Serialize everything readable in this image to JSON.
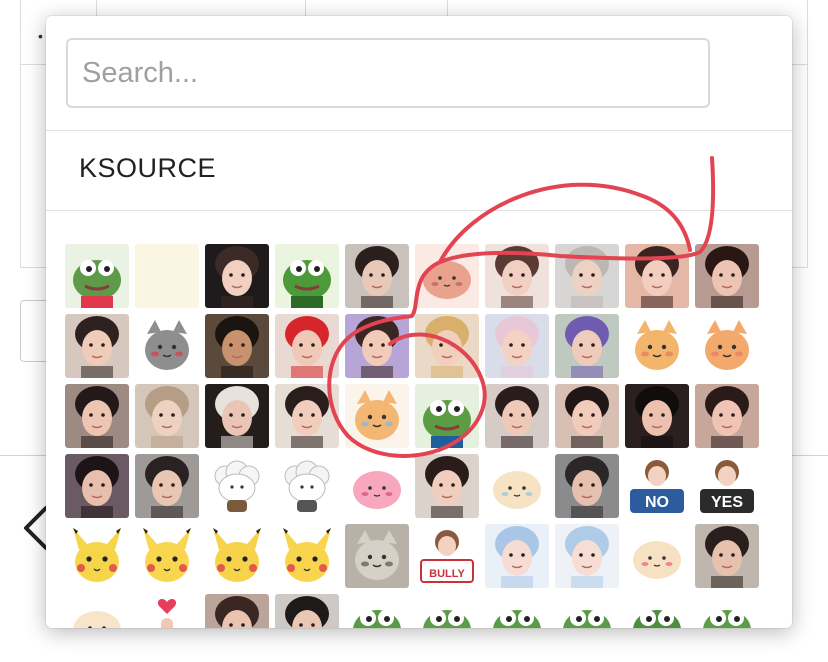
{
  "search": {
    "placeholder": "Search..."
  },
  "section": {
    "title": "KSOURCE"
  },
  "emotes": [
    {
      "name": "peepo-heart",
      "kind": "frog",
      "bg": "#e9f2e3",
      "fg": "#5d9a4a",
      "acc": "#e0394b"
    },
    {
      "name": "duck-cry",
      "kind": "duck",
      "bg": "#fbf6e4",
      "fg": "#f5dd6a",
      "acc": "#f29bb0"
    },
    {
      "name": "girl-pray",
      "kind": "face",
      "bg": "#1f1b1c",
      "fg": "#f1cfc1",
      "acc": "#3b2a26"
    },
    {
      "name": "pepe-dance",
      "kind": "frog",
      "bg": "#eaf4df",
      "fg": "#4c9a3a",
      "acc": "#2d6a26"
    },
    {
      "name": "girl-dab",
      "kind": "face",
      "bg": "#c9c1bc",
      "fg": "#e8c9b8",
      "acc": "#2a1f1d"
    },
    {
      "name": "potato-blob",
      "kind": "blob",
      "bg": "#fbe9e3",
      "fg": "#e8a28d",
      "acc": "#b66a5c"
    },
    {
      "name": "girl-yawn",
      "kind": "face",
      "bg": "#efe1dc",
      "fg": "#f2cfc3",
      "acc": "#5a3a33"
    },
    {
      "name": "boy-smirk",
      "kind": "face",
      "bg": "#d7d6d4",
      "fg": "#efd1c3",
      "acc": "#bdb7b3"
    },
    {
      "name": "girl-hands",
      "kind": "face",
      "bg": "#e4b7a7",
      "fg": "#f3cdbd",
      "acc": "#3b2320"
    },
    {
      "name": "girl-sad",
      "kind": "face",
      "bg": "#b79b92",
      "fg": "#ecc4b4",
      "acc": "#2a1714"
    },
    {
      "name": "boy-closeup",
      "kind": "face",
      "bg": "#d6c7bf",
      "fg": "#efcbb9",
      "acc": "#2e2220"
    },
    {
      "name": "cat-heart",
      "kind": "cat",
      "bg": "#ffffff",
      "fg": "#8e8e8e",
      "acc": "#e0394b"
    },
    {
      "name": "man-grin",
      "kind": "face",
      "bg": "#5b4a3c",
      "fg": "#c9926f",
      "acc": "#1b1511"
    },
    {
      "name": "red-glasses",
      "kind": "face",
      "bg": "#e8d9d3",
      "fg": "#f0c8b6",
      "acc": "#d7262b"
    },
    {
      "name": "girl-purple",
      "kind": "face",
      "bg": "#b7a5d8",
      "fg": "#f1cab9",
      "acc": "#3a2724"
    },
    {
      "name": "boy-blond",
      "kind": "face",
      "bg": "#e9d9c6",
      "fg": "#f1cfbc",
      "acc": "#d9b06b"
    },
    {
      "name": "girl-sip",
      "kind": "face",
      "bg": "#d9dde9",
      "fg": "#f3d2c4",
      "acc": "#e8c7d6"
    },
    {
      "name": "girl-drink",
      "kind": "face",
      "bg": "#c0c9c0",
      "fg": "#efcbbb",
      "acc": "#6f5bb0"
    },
    {
      "name": "cat-pout",
      "kind": "cat",
      "bg": "#ffffff",
      "fg": "#f2b56b",
      "acc": "#e07a5f"
    },
    {
      "name": "cat-cry",
      "kind": "cat",
      "bg": "#ffffff",
      "fg": "#f4a96c",
      "acc": "#e27b62"
    },
    {
      "name": "girl-smile",
      "kind": "face",
      "bg": "#9d8a82",
      "fg": "#edc6b3",
      "acc": "#23191a"
    },
    {
      "name": "girl-blur",
      "kind": "face",
      "bg": "#d4c6b9",
      "fg": "#eed2c1",
      "acc": "#b69e86"
    },
    {
      "name": "girl-math",
      "kind": "face",
      "bg": "#251d1c",
      "fg": "#eac4b4",
      "acc": "#e8e2dc"
    },
    {
      "name": "girl-lips",
      "kind": "face",
      "bg": "#e6ddd5",
      "fg": "#f0cdbd",
      "acc": "#2a1e1c"
    },
    {
      "name": "cat-sweat",
      "kind": "cat",
      "bg": "#fbf4ea",
      "fg": "#f3b773",
      "acc": "#7fb6e6"
    },
    {
      "name": "pepe-shy",
      "kind": "frog",
      "bg": "#e6f0de",
      "fg": "#5c9c45",
      "acc": "#1f5e9c"
    },
    {
      "name": "girl-shock",
      "kind": "face",
      "bg": "#d6ccc7",
      "fg": "#efc9b8",
      "acc": "#2a1c1b"
    },
    {
      "name": "girl-cheek",
      "kind": "face",
      "bg": "#d8bfb4",
      "fg": "#f1cbbb",
      "acc": "#1f1616"
    },
    {
      "name": "girl-hairhold",
      "kind": "face",
      "bg": "#2a2020",
      "fg": "#ecc1b0",
      "acc": "#120d0d"
    },
    {
      "name": "girl-pink",
      "kind": "face",
      "bg": "#c8a79b",
      "fg": "#efc4b4",
      "acc": "#2a1a18"
    },
    {
      "name": "girl-think",
      "kind": "face",
      "bg": "#6a5a63",
      "fg": "#e8bfae",
      "acc": "#1c1417"
    },
    {
      "name": "boy-point",
      "kind": "face",
      "bg": "#9e9a98",
      "fg": "#e9c6b4",
      "acc": "#2a2222"
    },
    {
      "name": "sheep-dance",
      "kind": "sheep",
      "bg": "#ffffff",
      "fg": "#f6f6f6",
      "acc": "#7a5a3a"
    },
    {
      "name": "sheep-run",
      "kind": "sheep",
      "bg": "#ffffff",
      "fg": "#f4f4f4",
      "acc": "#555555"
    },
    {
      "name": "pink-bunny",
      "kind": "blob",
      "bg": "#ffffff",
      "fg": "#f7a8bf",
      "acc": "#d9567f"
    },
    {
      "name": "girl-straw",
      "kind": "face",
      "bg": "#dcd2cc",
      "fg": "#f1cdbd",
      "acc": "#2a1c1b"
    },
    {
      "name": "blob-tea",
      "kind": "blob",
      "bg": "#ffffff",
      "fg": "#f6e3c4",
      "acc": "#9cc7dc"
    },
    {
      "name": "boy-stare",
      "kind": "face",
      "bg": "#8b8a8c",
      "fg": "#e6c0ae",
      "acc": "#2b2627"
    },
    {
      "name": "no-sign",
      "kind": "sign",
      "bg": "#ffffff",
      "fg": "#2c5b9e",
      "acc": "#8a5a3d",
      "text": "NO"
    },
    {
      "name": "yes-sign",
      "kind": "sign",
      "bg": "#ffffff",
      "fg": "#2b2b2b",
      "acc": "#8a5a3d",
      "text": "YES"
    },
    {
      "name": "pikachu-gun",
      "kind": "pika",
      "bg": "#ffffff",
      "fg": "#f7d54a",
      "acc": "#333333"
    },
    {
      "name": "pikachu-hide",
      "kind": "pika",
      "bg": "#ffffff",
      "fg": "#f8d650",
      "acc": "#2c2c2c"
    },
    {
      "name": "pikachu-smile",
      "kind": "pika",
      "bg": "#ffffff",
      "fg": "#f6d34b",
      "acc": "#e35a4b"
    },
    {
      "name": "pikachu-heart",
      "kind": "pika",
      "bg": "#ffffff",
      "fg": "#f8d54c",
      "acc": "#e94b6a"
    },
    {
      "name": "cat-sad",
      "kind": "cat",
      "bg": "#b7b1a8",
      "fg": "#d7d0c6",
      "acc": "#5a534c"
    },
    {
      "name": "bully-sign",
      "kind": "sign",
      "bg": "#ffffff",
      "fg": "#c9323b",
      "acc": "#e6ecf4",
      "text": "BULLY"
    },
    {
      "name": "anime-girl",
      "kind": "face",
      "bg": "#eaf0f7",
      "fg": "#f6ddd3",
      "acc": "#a9c6e6"
    },
    {
      "name": "anime-angry",
      "kind": "face",
      "bg": "#eef2f7",
      "fg": "#f7ded4",
      "acc": "#aecbe7"
    },
    {
      "name": "blob-heart",
      "kind": "blob",
      "bg": "#ffffff",
      "fg": "#f6e2c2",
      "acc": "#e66f8e"
    },
    {
      "name": "boy-blow",
      "kind": "face",
      "bg": "#bfb6ae",
      "fg": "#e6c1ad",
      "acc": "#2a1f1c"
    },
    {
      "name": "blob-sleep",
      "kind": "blob",
      "bg": "#ffffff",
      "fg": "#f7e4c9",
      "acc": "#e6a56a"
    },
    {
      "name": "finger-heart",
      "kind": "hand",
      "bg": "#ffffff",
      "fg": "#f3c7b4",
      "acc": "#e83d5d"
    },
    {
      "name": "boy-hands",
      "kind": "face",
      "bg": "#bba59a",
      "fg": "#eac3b1",
      "acc": "#3a2723"
    },
    {
      "name": "man-glasses",
      "kind": "face",
      "bg": "#cfc9c6",
      "fg": "#ebc6b3",
      "acc": "#1e1a1a"
    },
    {
      "name": "pepe-sad",
      "kind": "frog",
      "bg": "#ffffff",
      "fg": "#5a9a45",
      "acc": "#2f6dbb"
    },
    {
      "name": "pepe-cry",
      "kind": "frog",
      "bg": "#ffffff",
      "fg": "#5c9c46",
      "acc": "#2f6dbb"
    },
    {
      "name": "pepe-smug",
      "kind": "frog",
      "bg": "#ffffff",
      "fg": "#5b9b44",
      "acc": "#c33a3a"
    },
    {
      "name": "pepe-detective",
      "kind": "frog",
      "bg": "#ffffff",
      "fg": "#5c9c46",
      "acc": "#222222"
    },
    {
      "name": "pepe-hands",
      "kind": "frog",
      "bg": "#ffffff",
      "fg": "#4f8e3e",
      "acc": "#2f6dbb"
    },
    {
      "name": "pepe-cross",
      "kind": "frog",
      "bg": "#ffffff",
      "fg": "#5c9c46",
      "acc": "#e3c04a"
    }
  ]
}
